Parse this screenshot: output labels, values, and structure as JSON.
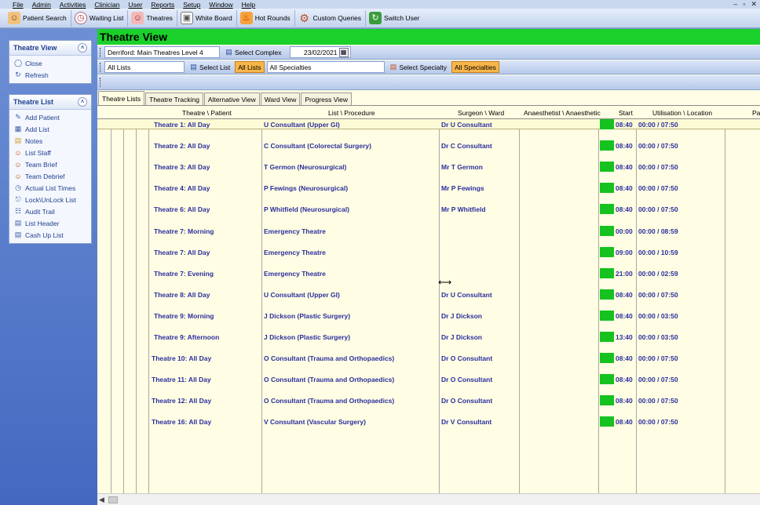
{
  "menu": {
    "items": [
      "File",
      "Admin",
      "Activities",
      "Clinician",
      "User",
      "Reports",
      "Setup",
      "Window",
      "Help"
    ],
    "window_controls": [
      "–",
      "▫",
      "✕"
    ]
  },
  "toolbar": {
    "buttons": [
      {
        "label": "Patient Search",
        "icon": "patient-search-icon"
      },
      {
        "label": "Waiting List",
        "icon": "clock-icon"
      },
      {
        "label": "Theatres",
        "icon": "surgeon-icon"
      },
      {
        "label": "White Board",
        "icon": "whiteboard-icon"
      },
      {
        "label": "Hot Rounds",
        "icon": "fire-icon"
      },
      {
        "label": "Custom Queries",
        "icon": "gear-icon"
      },
      {
        "label": "Switch User",
        "icon": "switch-user-icon"
      }
    ]
  },
  "left": {
    "theatre_view": {
      "title": "Theatre View",
      "items": [
        {
          "label": "Close",
          "icon": "close-circle-icon"
        },
        {
          "label": "Refresh",
          "icon": "refresh-icon"
        }
      ]
    },
    "theatre_list": {
      "title": "Theatre List",
      "items": [
        {
          "label": "Add Patient",
          "icon": "add-patient-icon"
        },
        {
          "label": "Add List",
          "icon": "add-list-icon"
        },
        {
          "label": "Notes",
          "icon": "notes-icon"
        },
        {
          "label": "List Staff",
          "icon": "staff-icon"
        },
        {
          "label": "Team Brief",
          "icon": "team-brief-icon"
        },
        {
          "label": "Team Debrief",
          "icon": "team-debrief-icon"
        },
        {
          "label": "Actual List Times",
          "icon": "list-times-icon"
        },
        {
          "label": "Lock\\UnLock List",
          "icon": "lock-icon"
        },
        {
          "label": "Audit Trail",
          "icon": "audit-icon"
        },
        {
          "label": "List Header",
          "icon": "list-header-icon"
        },
        {
          "label": "Cash Up List",
          "icon": "cash-up-icon"
        }
      ]
    }
  },
  "main": {
    "title": "Theatre View",
    "complex_value": "Derriford: Main Theatres Level 4",
    "select_complex_label": "Select Complex",
    "date_value": "23/02/2021",
    "list_value": "All Lists",
    "select_list_label": "Select List",
    "all_lists_label": "All Lists",
    "specialty_value": "All Specialties",
    "select_specialty_label": "Select Specialty",
    "all_specialties_label": "All Specialties",
    "tabs": [
      "Theatre Lists",
      "Theatre Tracking",
      "Alternative View",
      "Ward View",
      "Progress View"
    ],
    "columns": [
      "Theatre \\ Patient",
      "List \\ Procedure",
      "Surgeon \\ Ward",
      "Anaesthetist \\ Anaesthetic",
      "Start",
      "Utilisation \\ Location",
      "Pa"
    ],
    "rows": [
      {
        "theatre": "Theatre 1: All Day",
        "list": "U Consultant (Upper GI)",
        "surgeon": "Dr U Consultant",
        "start": "08:40",
        "util": "00:00 / 07:50"
      },
      {
        "theatre": "Theatre 2: All Day",
        "list": "C Consultant (Colorectal Surgery)",
        "surgeon": "Dr C Consultant",
        "start": "08:40",
        "util": "00:00 / 07:50"
      },
      {
        "theatre": "Theatre 3: All Day",
        "list": "T Germon (Neurosurgical)",
        "surgeon": "Mr T Germon",
        "start": "08:40",
        "util": "00:00 / 07:50"
      },
      {
        "theatre": "Theatre 4: All Day",
        "list": "P Fewings (Neurosurgical)",
        "surgeon": "Mr P Fewings",
        "start": "08:40",
        "util": "00:00 / 07:50"
      },
      {
        "theatre": "Theatre 6: All Day",
        "list": "P Whitfield (Neurosurgical)",
        "surgeon": "Mr P Whitfield",
        "start": "08:40",
        "util": "00:00 / 07:50"
      },
      {
        "theatre": "Theatre 7: Morning",
        "list": "Emergency Theatre",
        "surgeon": "",
        "start": "00:00",
        "util": "00:00 / 08:59"
      },
      {
        "theatre": "Theatre 7: All Day",
        "list": "Emergency Theatre",
        "surgeon": "",
        "start": "09:00",
        "util": "00:00 / 10:59"
      },
      {
        "theatre": "Theatre 7: Evening",
        "list": "Emergency Theatre",
        "surgeon": "",
        "start": "21:00",
        "util": "00:00 / 02:59"
      },
      {
        "theatre": "Theatre 8: All Day",
        "list": "U Consultant (Upper GI)",
        "surgeon": "Dr U Consultant",
        "start": "08:40",
        "util": "00:00 / 07:50"
      },
      {
        "theatre": "Theatre 9: Morning",
        "list": "J Dickson (Plastic Surgery)",
        "surgeon": "Dr J Dickson",
        "start": "08:40",
        "util": "00:00 / 03:50"
      },
      {
        "theatre": "Theatre 9: Afternoon",
        "list": "J Dickson (Plastic Surgery)",
        "surgeon": "Dr J Dickson",
        "start": "13:40",
        "util": "00:00 / 03:50"
      },
      {
        "theatre": "Theatre 10: All Day",
        "list": "O Consultant (Trauma and Orthopaedics)",
        "surgeon": "Dr O Consultant",
        "start": "08:40",
        "util": "00:00 / 07:50"
      },
      {
        "theatre": "Theatre 11: All Day",
        "list": "O Consultant (Trauma and Orthopaedics)",
        "surgeon": "Dr O Consultant",
        "start": "08:40",
        "util": "00:00 / 07:50"
      },
      {
        "theatre": "Theatre 12: All Day",
        "list": "O Consultant (Trauma and Orthopaedics)",
        "surgeon": "Dr O Consultant",
        "start": "08:40",
        "util": "00:00 / 07:50"
      },
      {
        "theatre": "Theatre 16: All Day",
        "list": "V Consultant (Vascular Surgery)",
        "surgeon": "Dr V Consultant",
        "start": "08:40",
        "util": "00:00 / 07:50"
      }
    ]
  },
  "colors": {
    "title_green": "#1ad12a",
    "status_green": "#15c21f",
    "row_text": "#2a2e9e",
    "active_filter": "#f8b64a",
    "panel_title": "#1e3f8e"
  }
}
